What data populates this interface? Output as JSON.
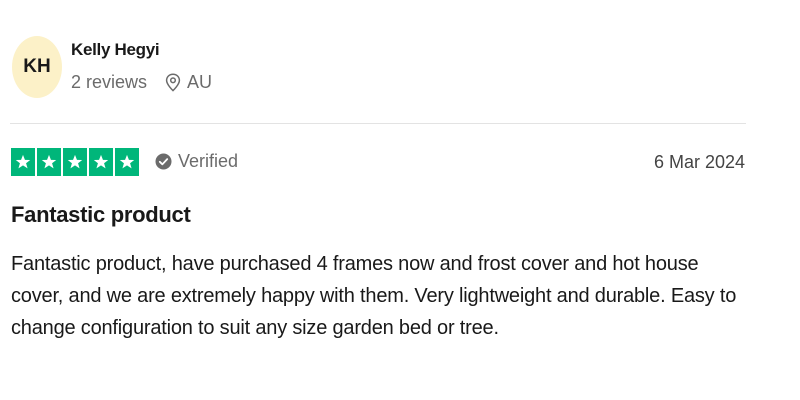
{
  "reviewer": {
    "initials": "KH",
    "name": "Kelly Hegyi",
    "reviews_count": "2 reviews",
    "country": "AU"
  },
  "review": {
    "rating": 5,
    "rating_max": 5,
    "verified_label": "Verified",
    "date": "6 Mar 2024",
    "title": "Fantastic product",
    "body": "Fantastic product, have purchased 4 frames now and frost cover and hot house cover, and we are extremely happy with them. Very lightweight and durable. Easy to change configuration to suit any size garden bed or tree."
  },
  "colors": {
    "star_green": "#00b67a",
    "avatar_bg": "#fcf1c8",
    "muted_text": "#6b6b6b",
    "divider": "#e3e3e3"
  },
  "icons": {
    "location": "map-pin-icon",
    "verified": "check-circle-icon",
    "star": "star-icon"
  }
}
